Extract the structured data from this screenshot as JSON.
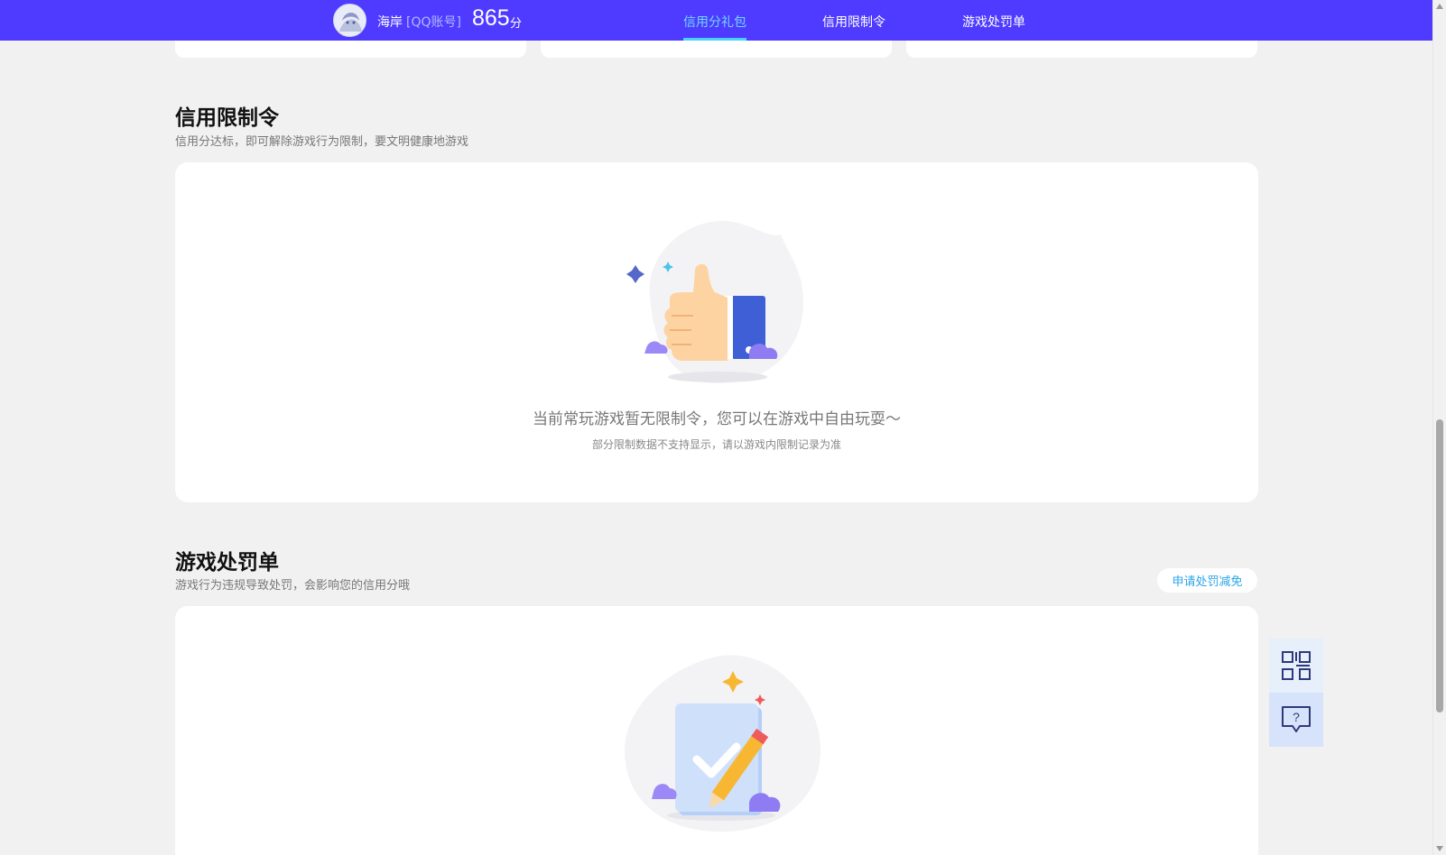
{
  "header": {
    "nickname": "海岸",
    "account_type": "[QQ账号]",
    "score": "865",
    "score_unit": "分",
    "tabs": [
      {
        "label": "信用分礼包",
        "active": true
      },
      {
        "label": "信用限制令",
        "active": false
      },
      {
        "label": "游戏处罚单",
        "active": false
      }
    ]
  },
  "restriction": {
    "title": "信用限制令",
    "subtitle": "信用分达标，即可解除游戏行为限制，要文明健康地游戏",
    "empty_text": "当前常玩游戏暂无限制令，您可以在游戏中自由玩耍～",
    "note": "部分限制数据不支持显示，请以游戏内限制记录为准"
  },
  "penalty": {
    "title": "游戏处罚单",
    "subtitle": "游戏行为违规导致处罚，会影响您的信用分哦",
    "reduce_button": "申请处罚减免"
  },
  "colors": {
    "nav_bg": "#4e3bff",
    "active_tab": "#6fd8ff",
    "link": "#2aa5e8"
  },
  "icons": {
    "side_1": "qr-code-icon",
    "side_2": "help-chat-icon"
  }
}
